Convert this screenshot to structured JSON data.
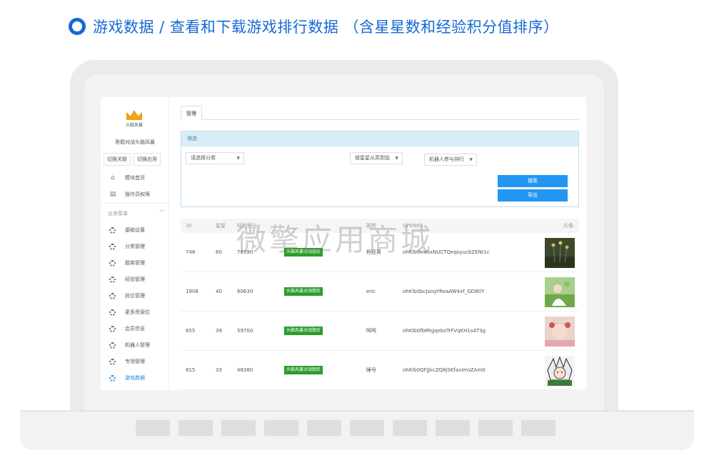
{
  "headline": "游戏数据 / 查看和下载游戏排行数据 （含星星数和经验积分值排序）",
  "watermark": "微擎应用商城",
  "sidebar": {
    "logo_text": "头脑风暴",
    "app_name": "答题对战头脑风暴",
    "switch_buttons": [
      "切换关联",
      "切换应用"
    ],
    "top_items": [
      {
        "icon": "home-icon",
        "label": "模块首页"
      },
      {
        "icon": "document-icon",
        "label": "操作员权限"
      }
    ],
    "group_label": "业务菜单",
    "items": [
      {
        "icon": "gear-icon",
        "label": "基础设置"
      },
      {
        "icon": "gear-icon",
        "label": "分类管理"
      },
      {
        "icon": "gear-icon",
        "label": "题库管理"
      },
      {
        "icon": "gear-icon",
        "label": "经验管理"
      },
      {
        "icon": "gear-icon",
        "label": "段位管理"
      },
      {
        "icon": "gear-icon",
        "label": "更多资源位"
      },
      {
        "icon": "gear-icon",
        "label": "会员信息"
      },
      {
        "icon": "gear-icon",
        "label": "机器人管理"
      },
      {
        "icon": "gear-icon",
        "label": "专场管理"
      },
      {
        "icon": "gear-icon",
        "label": "游戏数据"
      }
    ],
    "active_item": "游戏数据"
  },
  "tabs": [
    {
      "label": "管理"
    }
  ],
  "filter": {
    "title": "筛选",
    "category_select": "请选择分类",
    "sort_select": "按星星从高到低",
    "robot_select": "机器人参与排行",
    "search_button": "搜索",
    "export_button": "导出"
  },
  "table": {
    "columns": [
      "ID",
      "星星",
      "经验积分",
      "",
      "昵称",
      "OPENID",
      "头像"
    ],
    "rows": [
      {
        "id": "748",
        "stars": "60",
        "exp": "78590",
        "tag": "头脑风暴对战题库",
        "nickname": "杨亚男",
        "openid": "ohKlb0ewsxNUCTQeqsyucbZENt1c"
      },
      {
        "id": "1908",
        "stars": "40",
        "exp": "60630",
        "tag": "头脑风暴对战题库",
        "nickname": "eric",
        "openid": "ohKlb0bcJsoqYReaAW4xf_GD8tlY"
      },
      {
        "id": "655",
        "stars": "39",
        "exp": "59700",
        "tag": "头脑风暴对战题库",
        "nickname": "呵呵",
        "openid": "ohKlb0fbMtgqebzTrFVqKH1s4T3g"
      },
      {
        "id": "815",
        "stars": "33",
        "exp": "48380",
        "tag": "头脑风暴对战题库",
        "nickname": "睡号",
        "openid": "ohKlb0QFJJkcZQ8jSKfavImsZAm0"
      }
    ]
  },
  "colors": {
    "accent": "#1569d6",
    "primary_button": "#2196f3",
    "tag_green": "#2a9d2a",
    "filter_head": "#d9edf7"
  }
}
